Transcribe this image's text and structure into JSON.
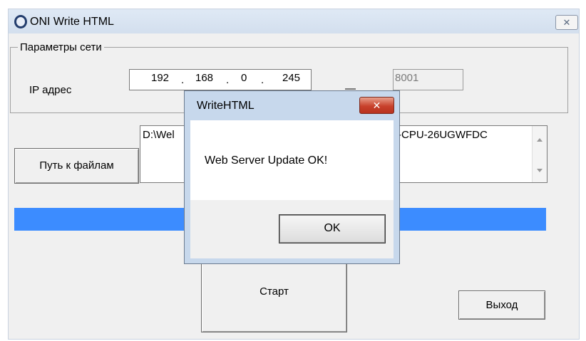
{
  "window": {
    "title": "ONI Write HTML",
    "close_glyph": "✕"
  },
  "network": {
    "legend": "Параметры сети",
    "ip_label": "IP адрес",
    "ip_octets": [
      "192",
      "168",
      "0",
      "245"
    ],
    "port_separator": "—",
    "port": "8001"
  },
  "files": {
    "button_label": "Путь к файлам",
    "path_visible_left": "D:\\Wel",
    "path_visible_right": "-CPU-26UGWFDC"
  },
  "progress": {
    "value": 1.0,
    "color": "#3c8cff"
  },
  "buttons": {
    "start_label": "Старт",
    "exit_label": "Выход"
  },
  "dialog": {
    "title": "WriteHTML",
    "close_glyph": "✕",
    "message": "Web Server Update OK!",
    "ok_label": "OK"
  }
}
